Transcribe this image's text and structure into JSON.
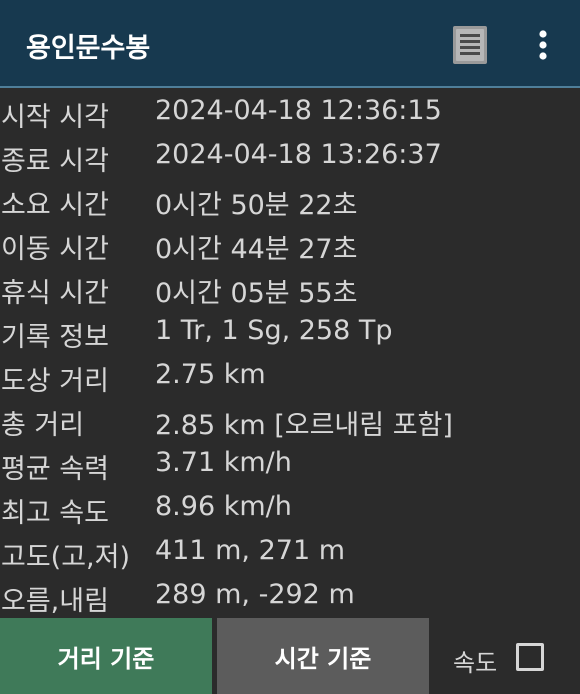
{
  "appbar": {
    "title": "용인문수봉",
    "icons": [
      "list-icon",
      "more-vert-icon"
    ]
  },
  "stats": [
    {
      "label": "시작 시각",
      "value": "2024-04-18 12:36:15"
    },
    {
      "label": "종료 시각",
      "value": "2024-04-18 13:26:37"
    },
    {
      "label": "소요 시간",
      "value": "0시간 50분 22초"
    },
    {
      "label": "이동 시간",
      "value": "0시간 44분 27초"
    },
    {
      "label": "휴식 시간",
      "value": "0시간 05분 55초"
    },
    {
      "label": "기록 정보",
      "value": "1 Tr, 1 Sg, 258 Tp"
    },
    {
      "label": "도상 거리",
      "value": "2.75 km"
    },
    {
      "label": "총 거리",
      "value": "2.85 km [오르내림 포함]"
    },
    {
      "label": "평균 속력",
      "value": "3.71 km/h"
    },
    {
      "label": "최고 속도",
      "value": "8.96 km/h"
    },
    {
      "label": "고도(고,저)",
      "value": "411 m, 271 m"
    },
    {
      "label": "오름,내림",
      "value": "289 m, -292 m"
    }
  ],
  "bottom": {
    "distance_button": "거리 기준",
    "time_button": "시간 기준",
    "speed_label": "속도",
    "speed_checked": false
  },
  "colors": {
    "appbar": "#17394f",
    "background": "#2b2b2b",
    "distance_button": "#3f7a59",
    "time_button": "#5c5c5c",
    "text": "#d6d6d6"
  }
}
